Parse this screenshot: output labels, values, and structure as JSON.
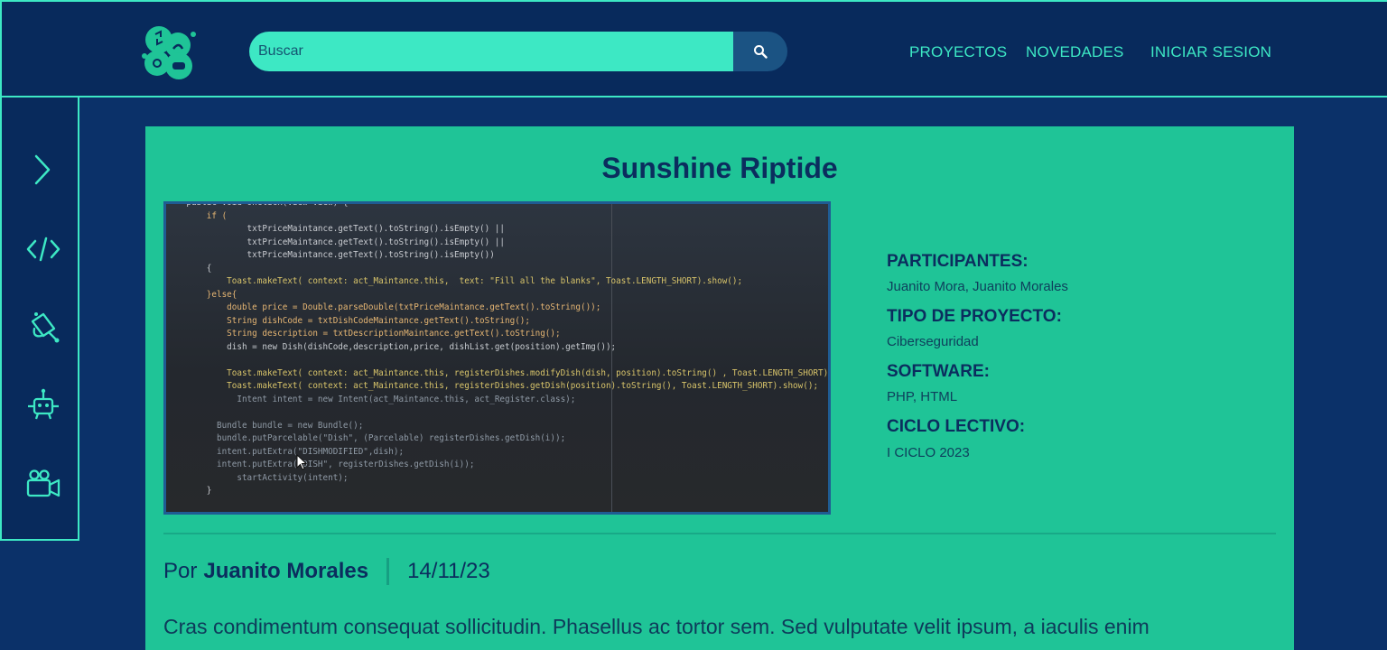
{
  "header": {
    "search_placeholder": "Buscar",
    "nav": [
      "PROYECTOS",
      "NOVEDADES",
      "INICIAR SESION"
    ]
  },
  "sidebar": {
    "icons": [
      "chevron-right-icon",
      "code-icon",
      "satellite-icon",
      "robot-icon",
      "video-camera-icon"
    ]
  },
  "post": {
    "title": "Sunshine Riptide",
    "participants_label": "PARTICIPANTES:",
    "participants": "Juanito Mora, Juanito Morales",
    "type_label": "TIPO DE PROYECTO:",
    "type": "Ciberseguridad",
    "software_label": "SOFTWARE:",
    "software": "PHP, HTML",
    "cycle_label": "CICLO LECTIVO:",
    "cycle": "I CICLO 2023",
    "by_prefix": "Por",
    "author": "Juanito Morales",
    "date": "14/11/23",
    "body": "Cras condimentum consequat sollicitudin. Phasellus ac tortor sem. Sed vulputate velit ipsum, a iaculis enim"
  },
  "code_screenshot": {
    "lines": [
      "    public void onClick(View view) {",
      "        if (",
      "                txtPriceMaintance.getText().toString().isEmpty() ||",
      "                txtPriceMaintance.getText().toString().isEmpty() ||",
      "                txtPriceMaintance.getText().toString().isEmpty())",
      "        {",
      "            Toast.makeText( context: act_Maintance.this,  text: \"Fill all the blanks\", Toast.LENGTH_SHORT).show();",
      "        }else{",
      "            double price = Double.parseDouble(txtPriceMaintance.getText().toString());",
      "            String dishCode = txtDishCodeMaintance.getText().toString();",
      "            String description = txtDescriptionMaintance.getText().toString();",
      "            dish = new Dish(dishCode,description,price, dishList.get(position).getImg());",
      "",
      "            Toast.makeText( context: act_Maintance.this, registerDishes.modifyDish(dish, position).toString() , Toast.LENGTH_SHORT).show();",
      "            Toast.makeText( context: act_Maintance.this, registerDishes.getDish(position).toString(), Toast.LENGTH_SHORT).show();",
      "              Intent intent = new Intent(act_Maintance.this, act_Register.class);",
      "",
      "          Bundle bundle = new Bundle();",
      "          bundle.putParcelable(\"Dish\", (Parcelable) registerDishes.getDish(i));",
      "          intent.putExtra(\"DISHMODIFIED\",dish);",
      "          intent.putExtra(\"DISH\", registerDishes.getDish(i));",
      "              startActivity(intent);",
      "        }"
    ]
  },
  "colors": {
    "page_bg": "#0b3169",
    "header_bg": "#082a5c",
    "accent": "#3de8c4",
    "card_bg": "#1fc497",
    "title": "#0b2d5e"
  }
}
